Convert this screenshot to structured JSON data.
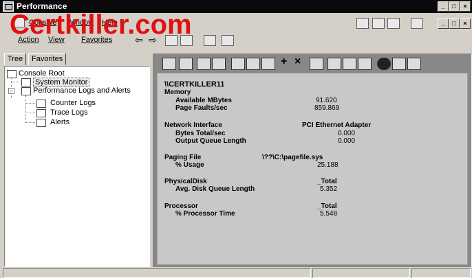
{
  "window": {
    "title": "Performance",
    "controls": {
      "minimize": "_",
      "maximize": "□",
      "close": "×"
    }
  },
  "watermark": "Certkiller.com",
  "menubar": {
    "items": [
      "Console",
      "Window",
      "Help"
    ]
  },
  "navbar": {
    "items": [
      "Action",
      "View",
      "Favorites"
    ]
  },
  "left_pane": {
    "tabs": [
      "Tree",
      "Favorites"
    ],
    "tree": [
      {
        "label": "Console Root",
        "level": 0,
        "icon": "folder-icon"
      },
      {
        "label": "System Monitor",
        "level": 1,
        "icon": "system-monitor-icon",
        "selected": true
      },
      {
        "label": "Performance Logs and Alerts",
        "level": 1,
        "icon": "performance-logs-icon",
        "expanded": true
      },
      {
        "label": "Counter Logs",
        "level": 2,
        "icon": "counter-logs-icon"
      },
      {
        "label": "Trace Logs",
        "level": 2,
        "icon": "trace-logs-icon"
      },
      {
        "label": "Alerts",
        "level": 2,
        "icon": "alerts-icon"
      }
    ]
  },
  "monitor_toolbar": {
    "buttons": [
      "new-counter-set-icon",
      "clear-display-icon",
      "view-current-activity-icon",
      "view-log-data-icon",
      "view-graph-icon",
      "view-histogram-icon",
      "view-report-icon",
      "add-counter-icon",
      "delete-counter-icon",
      "highlight-icon",
      "copy-properties-icon",
      "paste-counter-list-icon",
      "properties-icon",
      "freeze-display-icon",
      "update-data-icon",
      "help-icon"
    ]
  },
  "report": {
    "computer": "\\\\CERTKILLER11",
    "objects": [
      {
        "name": "Memory",
        "instance": "",
        "counters": [
          {
            "name": "Available MBytes",
            "value": "91.620"
          },
          {
            "name": "Page Faults/sec",
            "value": "859.869"
          }
        ]
      },
      {
        "name": "Network Interface",
        "instance": "PCI Ethernet Adapter",
        "counters": [
          {
            "name": "Bytes Total/sec",
            "value": "0.000"
          },
          {
            "name": "Output Queue Length",
            "value": "0.000"
          }
        ]
      },
      {
        "name": "Paging File",
        "instance": "\\??\\C:\\pagefile.sys",
        "counters": [
          {
            "name": "% Usage",
            "value": "25.188"
          }
        ]
      },
      {
        "name": "PhysicalDisk",
        "instance": "_Total",
        "counters": [
          {
            "name": "Avg. Disk Queue Length",
            "value": "5.352"
          }
        ]
      },
      {
        "name": "Processor",
        "instance": "_Total",
        "counters": [
          {
            "name": "% Processor Time",
            "value": "5.548"
          }
        ]
      }
    ]
  }
}
